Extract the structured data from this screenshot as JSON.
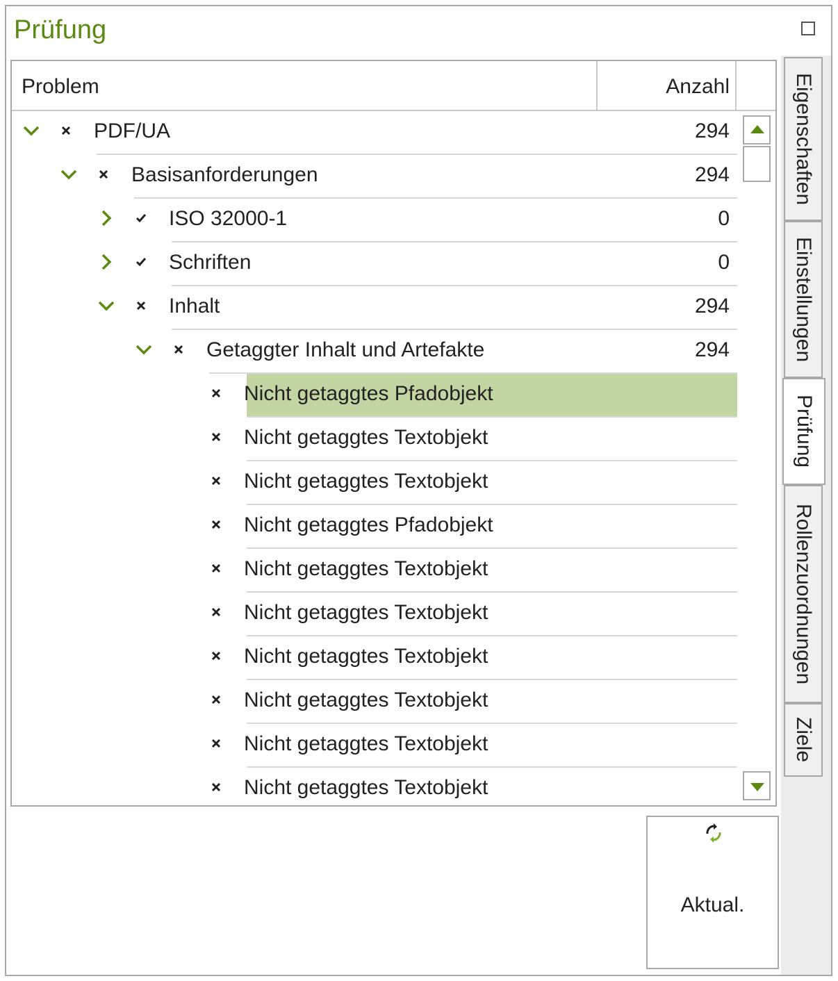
{
  "panel": {
    "title": "Prüfung",
    "accent_color": "#5b8a12",
    "highlight_color": "#c3d5a3"
  },
  "tree": {
    "columns": {
      "problem": "Problem",
      "count": "Anzahl"
    },
    "rows": [
      {
        "level": 0,
        "expander": "expanded",
        "status": "error",
        "label": "PDF/UA",
        "count": "294",
        "selected": false
      },
      {
        "level": 1,
        "expander": "expanded",
        "status": "error",
        "label": "Basisanforderungen",
        "count": "294",
        "selected": false
      },
      {
        "level": 2,
        "expander": "collapsed",
        "status": "ok",
        "label": "ISO 32000-1",
        "count": "0",
        "selected": false
      },
      {
        "level": 2,
        "expander": "collapsed",
        "status": "ok",
        "label": "Schriften",
        "count": "0",
        "selected": false
      },
      {
        "level": 2,
        "expander": "expanded",
        "status": "error",
        "label": "Inhalt",
        "count": "294",
        "selected": false
      },
      {
        "level": 3,
        "expander": "expanded",
        "status": "error",
        "label": "Getaggter Inhalt und Artefakte",
        "count": "294",
        "selected": false
      },
      {
        "level": 4,
        "expander": "none",
        "status": "error",
        "label": "Nicht getaggtes Pfadobjekt",
        "count": "",
        "selected": true
      },
      {
        "level": 4,
        "expander": "none",
        "status": "error",
        "label": "Nicht getaggtes Textobjekt",
        "count": "",
        "selected": false
      },
      {
        "level": 4,
        "expander": "none",
        "status": "error",
        "label": "Nicht getaggtes Textobjekt",
        "count": "",
        "selected": false
      },
      {
        "level": 4,
        "expander": "none",
        "status": "error",
        "label": "Nicht getaggtes Pfadobjekt",
        "count": "",
        "selected": false
      },
      {
        "level": 4,
        "expander": "none",
        "status": "error",
        "label": "Nicht getaggtes Textobjekt",
        "count": "",
        "selected": false
      },
      {
        "level": 4,
        "expander": "none",
        "status": "error",
        "label": "Nicht getaggtes Textobjekt",
        "count": "",
        "selected": false
      },
      {
        "level": 4,
        "expander": "none",
        "status": "error",
        "label": "Nicht getaggtes Textobjekt",
        "count": "",
        "selected": false
      },
      {
        "level": 4,
        "expander": "none",
        "status": "error",
        "label": "Nicht getaggtes Textobjekt",
        "count": "",
        "selected": false
      },
      {
        "level": 4,
        "expander": "none",
        "status": "error",
        "label": "Nicht getaggtes Textobjekt",
        "count": "",
        "selected": false
      },
      {
        "level": 4,
        "expander": "none",
        "status": "error",
        "label": "Nicht getaggtes Textobjekt",
        "count": "",
        "selected": false
      }
    ]
  },
  "tabs": [
    {
      "label": "Eigenschaften",
      "active": false
    },
    {
      "label": "Einstellungen",
      "active": false
    },
    {
      "label": "Prüfung",
      "active": true
    },
    {
      "label": "Rollenzuordnungen",
      "active": false
    },
    {
      "label": "Ziele",
      "active": false
    }
  ],
  "refresh_button": {
    "label": "Aktual.",
    "icon": "refresh-icon"
  }
}
